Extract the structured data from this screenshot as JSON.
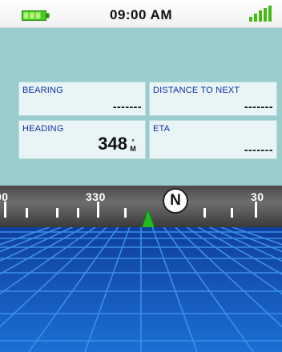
{
  "status": {
    "time": "09:00 AM",
    "battery_icon": "battery-icon",
    "signal_icon": "signal-strength-icon",
    "battery_color": "#44cc22",
    "signal_color": "#44bb11"
  },
  "fields": {
    "bearing": {
      "label": "BEARING",
      "value": "-------"
    },
    "distance_to_next": {
      "label": "DISTANCE TO NEXT",
      "value": "-------"
    },
    "heading": {
      "label": "HEADING",
      "value": "348",
      "unit_top": "°",
      "unit_bottom": "M"
    },
    "eta": {
      "label": "ETA",
      "value": "-------"
    }
  },
  "compass": {
    "labels": [
      "00",
      "330",
      "30"
    ],
    "north_label": "N",
    "pointer_color": "#22bb22"
  },
  "colors": {
    "panel": "#99cccc",
    "field_bg": "#e8f4f5",
    "label_text": "#0f2fa3",
    "grid_sky": "#0f4fb8"
  }
}
